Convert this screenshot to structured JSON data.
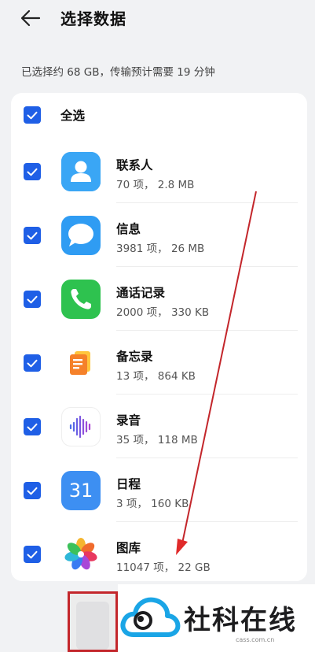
{
  "header": {
    "title": "选择数据",
    "back_icon": "arrow-left-icon"
  },
  "summary": "已选择约 68 GB，传输预计需要 19 分钟",
  "select_all": {
    "label": "全选",
    "checked": true
  },
  "items": [
    {
      "name": "联系人",
      "meta": "70 项， 2.8 MB",
      "icon": "contacts-icon",
      "checked": true
    },
    {
      "name": "信息",
      "meta": "3981 项， 26 MB",
      "icon": "messages-icon",
      "checked": true
    },
    {
      "name": "通话记录",
      "meta": "2000 项， 330 KB",
      "icon": "phone-icon",
      "checked": true
    },
    {
      "name": "备忘录",
      "meta": "13 项， 864 KB",
      "icon": "notes-icon",
      "checked": true
    },
    {
      "name": "录音",
      "meta": "35 项， 118 MB",
      "icon": "recorder-icon",
      "checked": true
    },
    {
      "name": "日程",
      "meta": "3 项， 160 KB",
      "icon": "calendar-icon",
      "calendar_day": "31",
      "checked": true
    },
    {
      "name": "图库",
      "meta": "11047 项， 22 GB",
      "icon": "gallery-icon",
      "checked": true
    }
  ],
  "watermark": {
    "text": "社科在线",
    "subtext": "cass.com.cn"
  },
  "colors": {
    "accent": "#1f5fe6",
    "annotation_red": "#c3262b",
    "background": "#f1f2f4"
  }
}
